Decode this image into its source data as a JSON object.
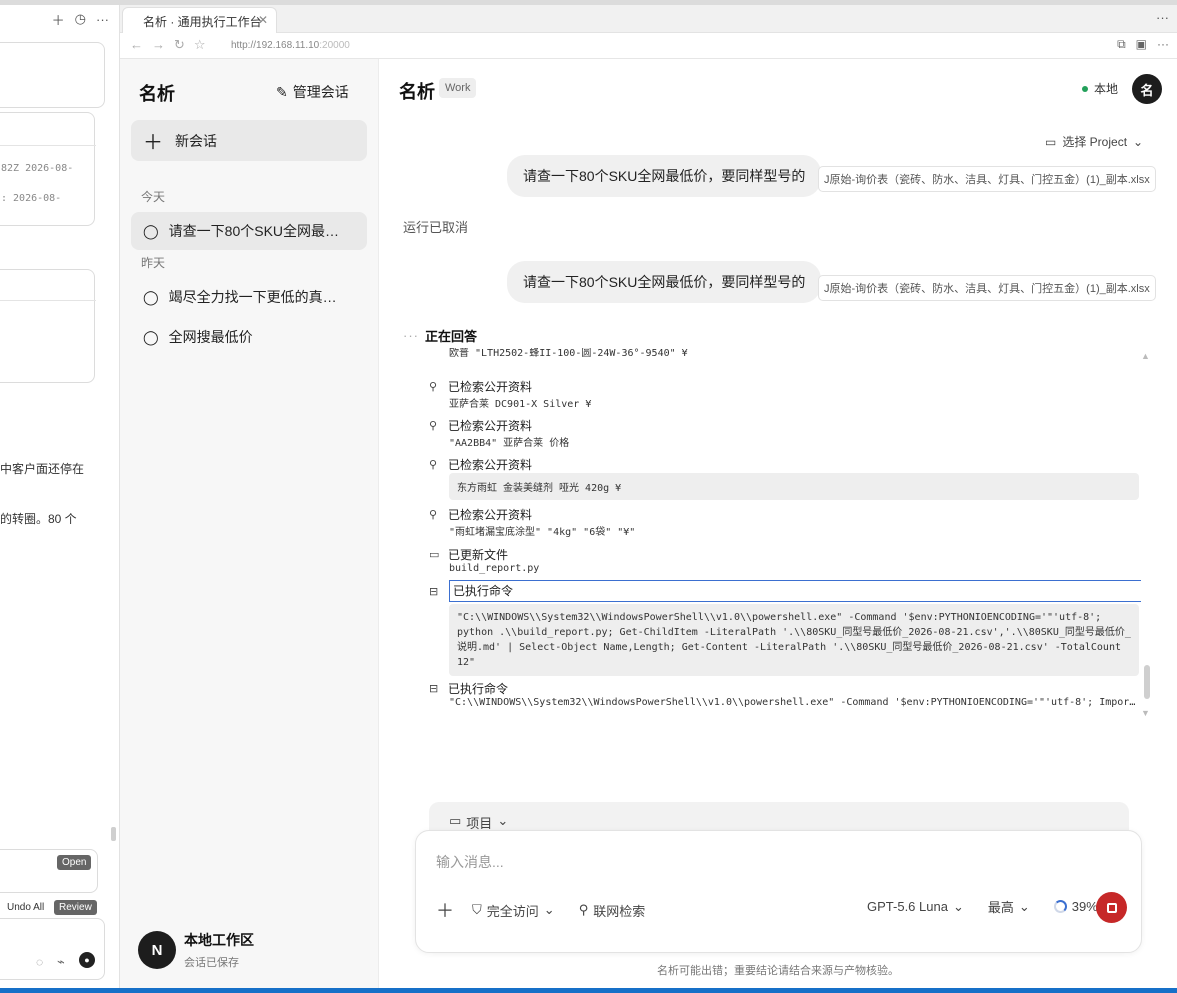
{
  "browser": {
    "tab_title": "名析 · 通用执行工作台",
    "url_host": "http://192.168.11.10",
    "url_port": ":20000"
  },
  "left_panel": {
    "mono_line1": "82Z 2026-08-",
    "mono_line2": ": 2026-08-",
    "text_line1": "中客户面还停在",
    "text_line2": "的转圈。80 个",
    "open_label": "Open",
    "undo_all_label": "Undo All",
    "review_label": "Review"
  },
  "sidebar": {
    "title": "名析",
    "manage_label": "管理会话",
    "new_chat_label": "新会话",
    "today_label": "今天",
    "yesterday_label": "昨天",
    "conversations": [
      {
        "label": "请查一下80个SKU全网最低价，要同样型号的"
      },
      {
        "label": "竭尽全力找一下更低的真实价格"
      },
      {
        "label": "全网搜最低价"
      }
    ],
    "workspace": {
      "avatar": "N",
      "name": "本地工作区",
      "status": "会话已保存"
    }
  },
  "main": {
    "title": "名析",
    "badge": "Work",
    "local_label": "本地",
    "avatar": "名",
    "project_select": "选择 Project",
    "messages": [
      {
        "text": "请查一下80个SKU全网最低价，要同样型号的",
        "file": "J原始-询价表（瓷砖、防水、洁具、灯具、门控五金）(1)_副本.xlsx"
      },
      {
        "text": "请查一下80个SKU全网最低价，要同样型号的",
        "file": "J原始-询价表（瓷砖、防水、洁具、灯具、门控五金）(1)_副本.xlsx"
      }
    ],
    "run_cancelled": "运行已取消",
    "answering_label": "正在回答",
    "activity": {
      "item0_detail": "欧普 \"LTH2502-蜂II-100-圆-24W-36°-9540\" ¥",
      "item1_head": "已检索公开资料",
      "item1_detail": "亚萨合莱 DC901-X Silver ¥",
      "item2_head": "已检索公开资料",
      "item2_detail": "\"AA2BB4\" 亚萨合莱 价格",
      "item3_head": "已检索公开资料",
      "item3_detail": "东方雨虹 金装美缝剂 哑光 420g ¥",
      "item4_head": "已检索公开资料",
      "item4_detail": "\"雨虹堵漏宝底涂型\" \"4kg\" \"6袋\" \"¥\"",
      "item5_head": "已更新文件",
      "item5_detail": "build_report.py",
      "item6_head": "已执行命令",
      "item6_detail": "\"C:\\\\WINDOWS\\\\System32\\\\WindowsPowerShell\\\\v1.0\\\\powershell.exe\" -Command '$env:PYTHONIOENCODING='\"'utf-8'; python .\\\\build_report.py; Get-ChildItem -LiteralPath '.\\\\80SKU_同型号最低价_2026-08-21.csv','.\\\\80SKU_同型号最低价_说明.md' | Select-Object Name,Length; Get-Content -LiteralPath '.\\\\80SKU_同型号最低价_2026-08-21.csv' -TotalCount 12\"",
      "item7_head": "已执行命令",
      "item7_detail": "\"C:\\\\WINDOWS\\\\System32\\\\WindowsPowerShell\\\\v1.0\\\\powershell.exe\" -Command '$env:PYTHONIOENCODING='\"'utf-8'; Import..."
    },
    "composer": {
      "project_label": "项目",
      "placeholder": "输入消息...",
      "access_label": "完全访问",
      "search_label": "联网检索",
      "model_label": "GPT-5.6 Luna",
      "effort_label": "最高",
      "progress_percent": "39%"
    },
    "footnote": "名析可能出错；重要结论请结合来源与产物核验。"
  },
  "colors": {
    "accent_blue": "#3b6fd0",
    "stop_red": "#c62828",
    "status_green": "#22a05a"
  }
}
